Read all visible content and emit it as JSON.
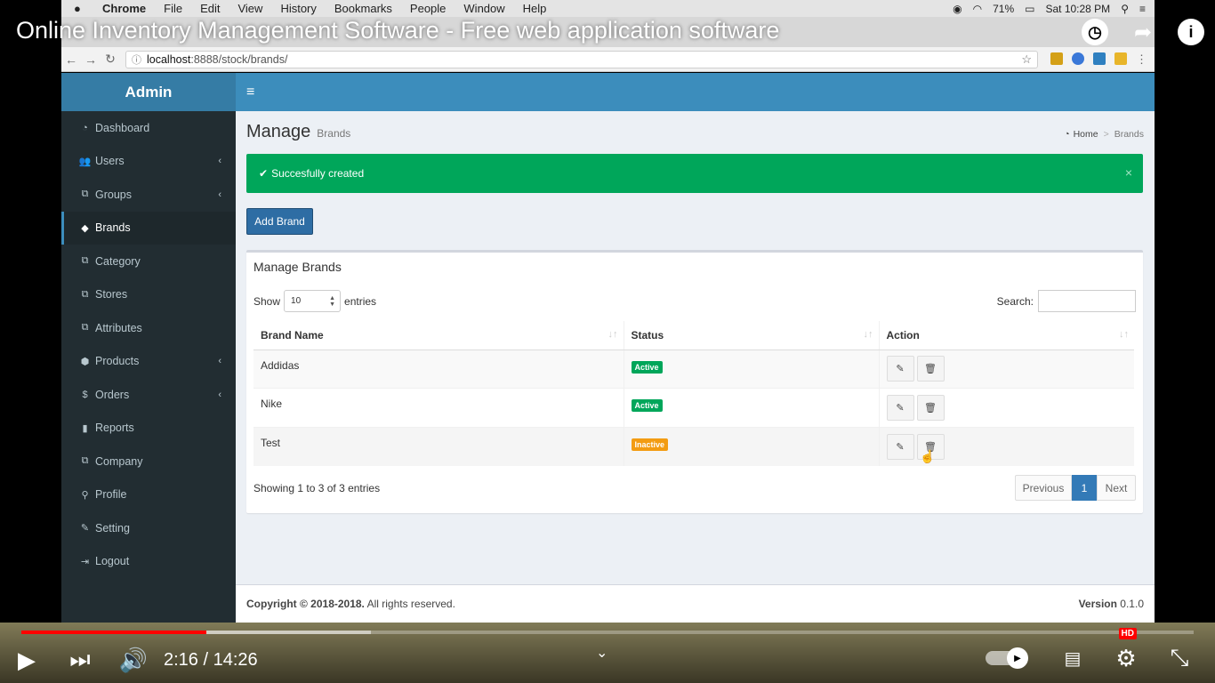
{
  "video": {
    "title": "Online Inventory Management Software - Free web application software",
    "time_current": "2:16",
    "time_total": "14:26",
    "progress_played": 0.158,
    "progress_buffered": 0.298,
    "hd_badge": "HD"
  },
  "mac_menu": {
    "apple": "",
    "items": [
      "Chrome",
      "File",
      "Edit",
      "View",
      "History",
      "Bookmarks",
      "People",
      "Window",
      "Help"
    ],
    "battery": "71%",
    "clock": "Sat 10:28 PM"
  },
  "browser": {
    "url_host": "localhost",
    "url_path": ":8888/stock/brands/"
  },
  "app": {
    "brand": "Admin",
    "sidebar": [
      {
        "label": "Dashboard",
        "icon": "dashboard-icon",
        "glyph": "◔",
        "chevron": false
      },
      {
        "label": "Users",
        "icon": "users-icon",
        "glyph": "👥",
        "chevron": true
      },
      {
        "label": "Groups",
        "icon": "groups-icon",
        "glyph": "⧉",
        "chevron": true
      },
      {
        "label": "Brands",
        "icon": "tags-icon",
        "glyph": "◆",
        "chevron": false,
        "active": true
      },
      {
        "label": "Category",
        "icon": "category-icon",
        "glyph": "⧉",
        "chevron": false
      },
      {
        "label": "Stores",
        "icon": "stores-icon",
        "glyph": "⧉",
        "chevron": false
      },
      {
        "label": "Attributes",
        "icon": "attributes-icon",
        "glyph": "⧉",
        "chevron": false
      },
      {
        "label": "Products",
        "icon": "products-icon",
        "glyph": "⬢",
        "chevron": true
      },
      {
        "label": "Orders",
        "icon": "dollar-icon",
        "glyph": "$",
        "chevron": true
      },
      {
        "label": "Reports",
        "icon": "bar-chart-icon",
        "glyph": "▮",
        "chevron": false
      },
      {
        "label": "Company",
        "icon": "company-icon",
        "glyph": "⧉",
        "chevron": false
      },
      {
        "label": "Profile",
        "icon": "user-icon",
        "glyph": "⚲",
        "chevron": false
      },
      {
        "label": "Setting",
        "icon": "wrench-icon",
        "glyph": "✎",
        "chevron": false
      },
      {
        "label": "Logout",
        "icon": "logout-icon",
        "glyph": "⇥",
        "chevron": false
      }
    ],
    "page_title": "Manage",
    "page_subtitle": "Brands",
    "breadcrumb": {
      "home": "Home",
      "current": "Brands"
    },
    "alert": "Succesfully created",
    "add_button": "Add Brand",
    "box_title": "Manage Brands",
    "show_label": "Show",
    "entries_label": "entries",
    "page_size": "10",
    "search_label": "Search:",
    "columns": [
      "Brand Name",
      "Status",
      "Action"
    ],
    "rows": [
      {
        "name": "Addidas",
        "status": "Active",
        "status_type": "ok"
      },
      {
        "name": "Nike",
        "status": "Active",
        "status_type": "ok"
      },
      {
        "name": "Test",
        "status": "Inactive",
        "status_type": "warn"
      }
    ],
    "showing": "Showing 1 to 3 of 3 entries",
    "pagination": {
      "prev": "Previous",
      "page": "1",
      "next": "Next"
    },
    "footer": {
      "copyright_strong": "Copyright © 2018-2018.",
      "copyright_rest": " All rights reserved.",
      "version_label": "Version",
      "version": "0.1.0"
    }
  },
  "colors": {
    "navbar": "#3c8dbc",
    "sidebar": "#222d32",
    "success": "#00a65a",
    "warning": "#f39c12"
  }
}
